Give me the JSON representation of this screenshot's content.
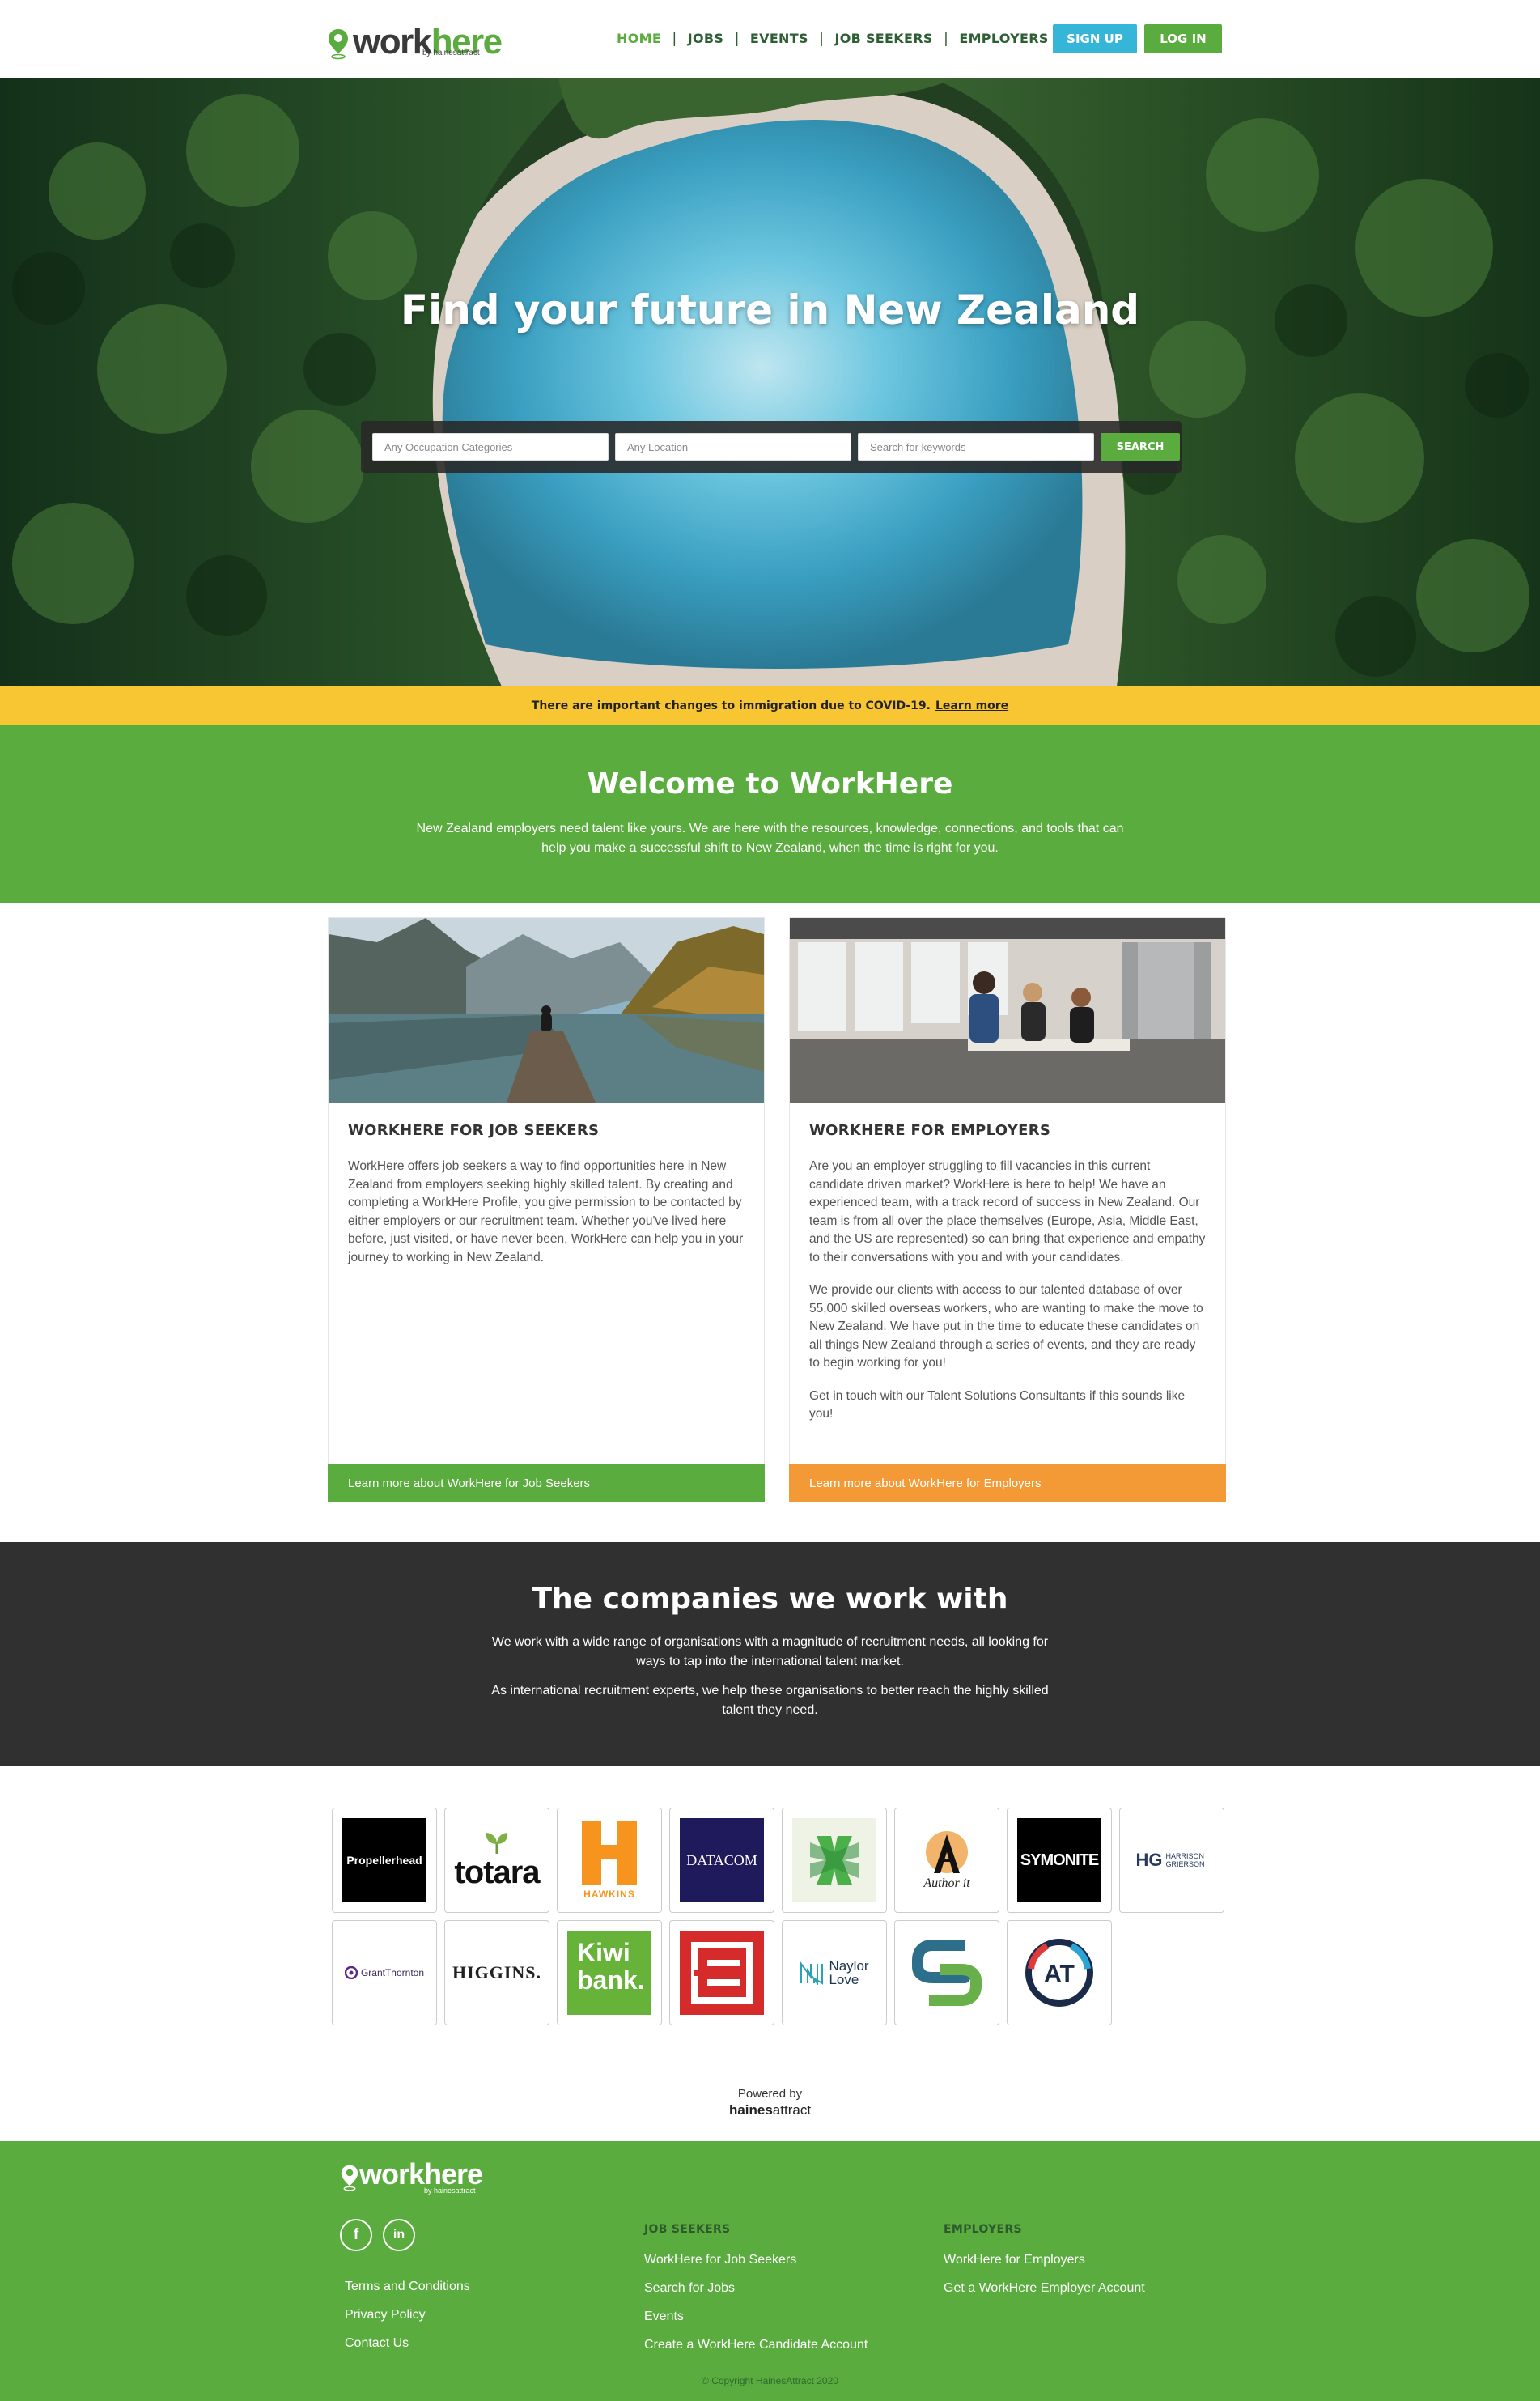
{
  "header": {
    "logo_text_a": "work",
    "logo_text_b": "here",
    "logo_by": "by hainesattract",
    "nav": [
      {
        "label": "HOME",
        "active": true
      },
      {
        "label": "JOBS"
      },
      {
        "label": "EVENTS"
      },
      {
        "label": "JOB SEEKERS"
      },
      {
        "label": "EMPLOYERS"
      }
    ],
    "signup_label": "SIGN UP",
    "login_label": "LOG IN"
  },
  "hero": {
    "title": "Find your future in New Zealand",
    "search": {
      "occupation_placeholder": "Any Occupation Categories",
      "location_placeholder": "Any Location",
      "keywords_placeholder": "Search for keywords",
      "button_label": "SEARCH"
    }
  },
  "covid_banner": {
    "text": "There are important changes to immigration due to COVID-19.",
    "link": "Learn more"
  },
  "welcome": {
    "title": "Welcome to WorkHere",
    "text": "New Zealand employers need talent like yours. We are here with the resources, knowledge, connections, and tools that can help you make a successful shift to New Zealand, when the time is right for you."
  },
  "cards": {
    "job_seekers": {
      "title": "WORKHERE FOR JOB SEEKERS",
      "paragraphs": [
        "WorkHere offers job seekers a way to find opportunities here in New Zealand from employers seeking highly skilled talent. By creating and completing a WorkHere Profile, you give permission to be contacted by either employers or our recruitment team. Whether you've lived here before, just visited, or have never been, WorkHere can help you in your journey to working in New Zealand."
      ],
      "cta": "Learn more about WorkHere for Job Seekers"
    },
    "employers": {
      "title": "WORKHERE FOR EMPLOYERS",
      "paragraphs": [
        "Are you an employer struggling to fill vacancies in this current candidate driven market? WorkHere is here to help! We have an experienced team, with a track record of success in New Zealand. Our team is from all over the place themselves (Europe, Asia, Middle East, and the US are represented) so can bring that experience and empathy to their conversations with you and with your candidates.",
        "We provide our clients with access to our talented database of over 55,000 skilled overseas workers, who are wanting to make the move to New Zealand. We have put in the time to educate these candidates on all things New Zealand through a series of events, and they are ready to begin working for you!",
        "Get in touch with our Talent Solutions Consultants if this sounds like you!"
      ],
      "cta": "Learn more about WorkHere for Employers"
    }
  },
  "companies": {
    "title": "The companies we work with",
    "p1": "We work with a wide range of organisations with a magnitude of recruitment needs, all looking for ways to tap into the international talent market.",
    "p2": "As international recruitment experts, we help these organisations to better reach the highly skilled talent they need.",
    "logos": [
      {
        "name": "Propellerhead",
        "text": "Propellerhead"
      },
      {
        "name": "totara",
        "text": "totara"
      },
      {
        "name": "Hawkins",
        "text": "HAWKINS"
      },
      {
        "name": "Datacom",
        "text": "DATACOM"
      },
      {
        "name": "green-cross",
        "text": ""
      },
      {
        "name": "Author-IT",
        "text": "Author it"
      },
      {
        "name": "Symonite",
        "text": "SYMONITE"
      },
      {
        "name": "Harrison Grierson",
        "text": "HARRISON GRIERSON"
      },
      {
        "name": "Grant Thornton",
        "text": "GrantThornton"
      },
      {
        "name": "Higgins",
        "text": "HIGGINS."
      },
      {
        "name": "Kiwibank",
        "text1": "Kiwi",
        "text2": "bank."
      },
      {
        "name": "E-logo",
        "text": ""
      },
      {
        "name": "Naylor Love",
        "text1": "Naylor",
        "text2": "Love"
      },
      {
        "name": "S-logo",
        "text": ""
      },
      {
        "name": "AT",
        "text": "AT"
      }
    ]
  },
  "powered": {
    "label": "Powered by",
    "brand_a": "haines",
    "brand_b": "attract"
  },
  "footer": {
    "logo_text": "workhere",
    "logo_by": "by hainesattract",
    "social": [
      {
        "name": "facebook",
        "glyph": "f"
      },
      {
        "name": "linkedin",
        "glyph": "in"
      }
    ],
    "legal_links": [
      "Terms and Conditions",
      "Privacy Policy",
      "Contact Us"
    ],
    "job_seekers": {
      "heading": "JOB SEEKERS",
      "links": [
        "WorkHere for Job Seekers",
        "Search for Jobs",
        "Events",
        "Create a WorkHere Candidate Account"
      ]
    },
    "employers": {
      "heading": "EMPLOYERS",
      "links": [
        "WorkHere for Employers",
        "Get a WorkHere Employer Account"
      ]
    },
    "copyright": "© Copyright HainesAttract 2020"
  },
  "colors": {
    "brand_green": "#5aac3e",
    "sign_up_blue": "#35b6d8",
    "banner_yellow": "#f9c633",
    "employer_orange": "#f39a37",
    "dark_section": "#303030"
  }
}
